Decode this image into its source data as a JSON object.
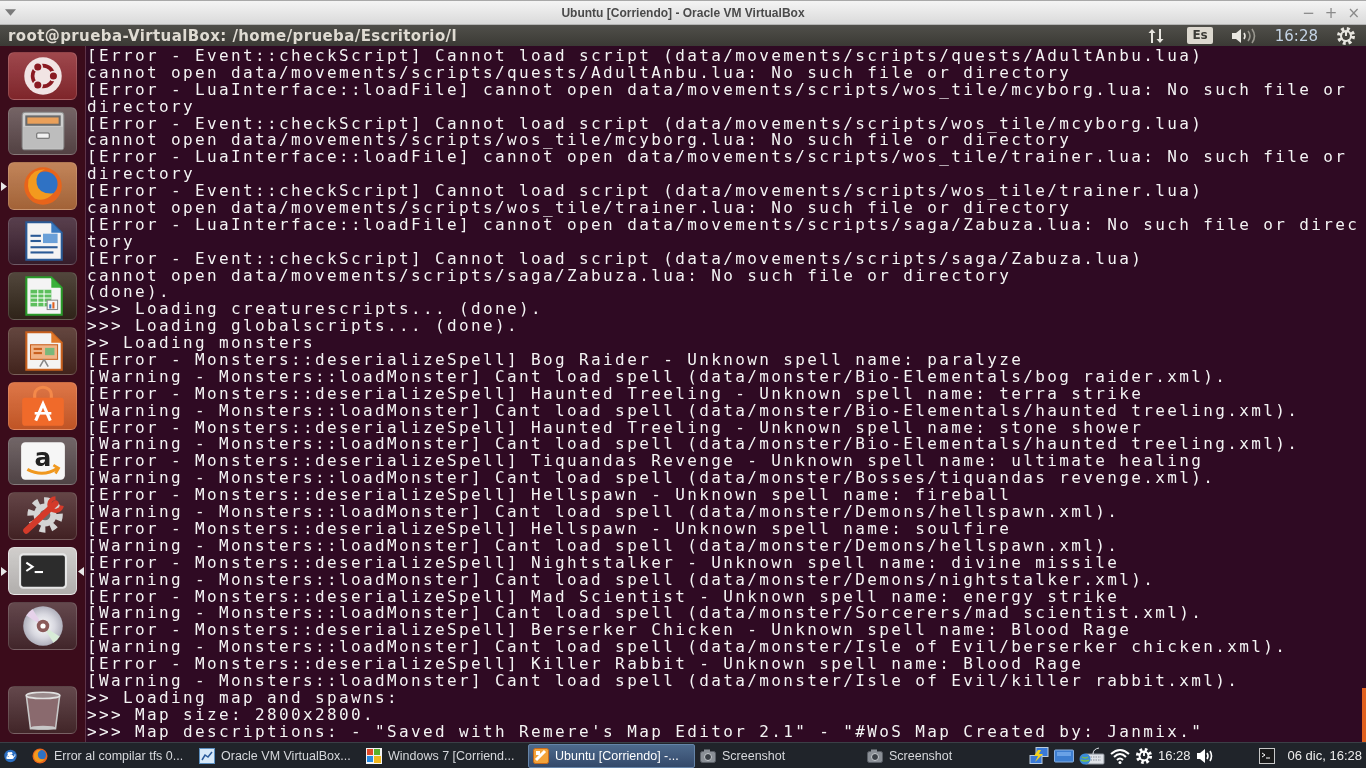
{
  "host_window": {
    "title": "Ubuntu [Corriendo] - Oracle VM VirtualBox",
    "controls": [
      "−",
      "+",
      "×"
    ]
  },
  "top_panel": {
    "title": "root@prueba-VirtualBox: /home/prueba/Escritorio/l",
    "keyboard_layout": "Es",
    "clock": "16:28"
  },
  "launcher": {
    "items": [
      {
        "kind": "dash",
        "running": false,
        "focused": false
      },
      {
        "kind": "files",
        "running": false,
        "focused": false
      },
      {
        "kind": "browser",
        "running": true,
        "focused": false
      },
      {
        "kind": "writer",
        "running": false,
        "focused": false
      },
      {
        "kind": "spreadsheet",
        "running": false,
        "focused": false
      },
      {
        "kind": "presentation",
        "running": false,
        "focused": false
      },
      {
        "kind": "software",
        "running": false,
        "focused": false
      },
      {
        "kind": "shop",
        "glyph": "a",
        "running": false,
        "focused": false
      },
      {
        "kind": "settings",
        "running": false,
        "focused": false
      },
      {
        "kind": "terminal",
        "running": true,
        "focused": true
      },
      {
        "kind": "disc",
        "running": false,
        "focused": false
      },
      {
        "kind": "trash",
        "running": false,
        "focused": false
      }
    ]
  },
  "terminal": {
    "lines": [
      "[Error - Event::checkScript] Cannot load script (data/movements/scripts/quests/AdultAnbu.lua)",
      "cannot open data/movements/scripts/quests/AdultAnbu.lua: No such file or directory",
      "[Error - LuaInterface::loadFile] cannot open data/movements/scripts/wos_tile/mcyborg.lua: No such file or",
      "directory",
      "[Error - Event::checkScript] Cannot load script (data/movements/scripts/wos_tile/mcyborg.lua)",
      "cannot open data/movements/scripts/wos_tile/mcyborg.lua: No such file or directory",
      "[Error - LuaInterface::loadFile] cannot open data/movements/scripts/wos_tile/trainer.lua: No such file or",
      "directory",
      "[Error - Event::checkScript] Cannot load script (data/movements/scripts/wos_tile/trainer.lua)",
      "cannot open data/movements/scripts/wos_tile/trainer.lua: No such file or directory",
      "[Error - LuaInterface::loadFile] cannot open data/movements/scripts/saga/Zabuza.lua: No such file or direc",
      "tory",
      "[Error - Event::checkScript] Cannot load script (data/movements/scripts/saga/Zabuza.lua)",
      "cannot open data/movements/scripts/saga/Zabuza.lua: No such file or directory",
      "(done).",
      ">>> Loading creaturescripts... (done).",
      ">>> Loading globalscripts... (done).",
      ">> Loading monsters",
      "[Error - Monsters::deserializeSpell] Bog Raider - Unknown spell name: paralyze",
      "[Warning - Monsters::loadMonster] Cant load spell (data/monster/Bio-Elementals/bog raider.xml).",
      "[Error - Monsters::deserializeSpell] Haunted Treeling - Unknown spell name: terra strike",
      "[Warning - Monsters::loadMonster] Cant load spell (data/monster/Bio-Elementals/haunted treeling.xml).",
      "[Error - Monsters::deserializeSpell] Haunted Treeling - Unknown spell name: stone shower",
      "[Warning - Monsters::loadMonster] Cant load spell (data/monster/Bio-Elementals/haunted treeling.xml).",
      "[Error - Monsters::deserializeSpell] Tiquandas Revenge - Unknown spell name: ultimate healing",
      "[Warning - Monsters::loadMonster] Cant load spell (data/monster/Bosses/tiquandas revenge.xml).",
      "[Error - Monsters::deserializeSpell] Hellspawn - Unknown spell name: fireball",
      "[Warning - Monsters::loadMonster] Cant load spell (data/monster/Demons/hellspawn.xml).",
      "[Error - Monsters::deserializeSpell] Hellspawn - Unknown spell name: soulfire",
      "[Warning - Monsters::loadMonster] Cant load spell (data/monster/Demons/hellspawn.xml).",
      "[Error - Monsters::deserializeSpell] Nightstalker - Unknown spell name: divine missile",
      "[Warning - Monsters::loadMonster] Cant load spell (data/monster/Demons/nightstalker.xml).",
      "[Error - Monsters::deserializeSpell] Mad Scientist - Unknown spell name: energy strike",
      "[Warning - Monsters::loadMonster] Cant load spell (data/monster/Sorcerers/mad scientist.xml).",
      "[Error - Monsters::deserializeSpell] Berserker Chicken - Unknown spell name: Blood Rage",
      "[Warning - Monsters::loadMonster] Cant load spell (data/monster/Isle of Evil/berserker chicken.xml).",
      "[Error - Monsters::deserializeSpell] Killer Rabbit - Unknown spell name: Blood Rage",
      "[Warning - Monsters::loadMonster] Cant load spell (data/monster/Isle of Evil/killer rabbit.xml).",
      ">> Loading map and spawns:",
      ">>> Map size: 2800x2800.",
      ">>> Map descriptions: - \"Saved with Remere's Map Editor 2.1\" - \"#WoS Map Created by: Janmix.\""
    ]
  },
  "taskbar": {
    "tasks": [
      {
        "kind": "browser",
        "label": "Error al compilar tfs 0...",
        "selected": false
      },
      {
        "kind": "virtualbox",
        "label": "Oracle VM VirtualBox...",
        "selected": false
      },
      {
        "kind": "windows",
        "label": "Windows 7 [Corriend...",
        "selected": false
      },
      {
        "kind": "vm",
        "label": "Ubuntu [Corriendo] -...",
        "selected": true
      },
      {
        "kind": "camera",
        "label": "Screenshot",
        "selected": false
      },
      {
        "kind": "camera",
        "label": "Screenshot",
        "selected": false
      }
    ],
    "clock": "16:28",
    "date_time": "06 dic, 16:28"
  }
}
